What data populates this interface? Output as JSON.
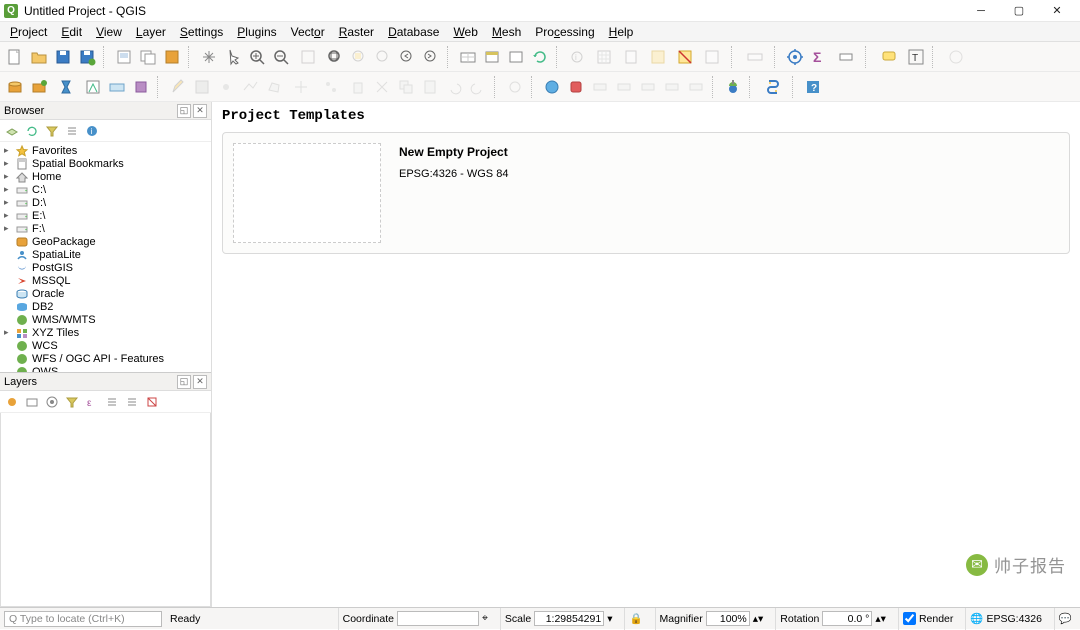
{
  "window": {
    "title": "Untitled Project - QGIS"
  },
  "menu": {
    "project": "Project",
    "edit": "Edit",
    "view": "View",
    "layer": "Layer",
    "settings": "Settings",
    "plugins": "Plugins",
    "vector": "Vector",
    "raster": "Raster",
    "database": "Database",
    "web": "Web",
    "mesh": "Mesh",
    "processing": "Processing",
    "help": "Help"
  },
  "browser": {
    "title": "Browser",
    "items": [
      {
        "label": "Favorites",
        "icon": "star",
        "expand": true
      },
      {
        "label": "Spatial Bookmarks",
        "icon": "bookmark",
        "expand": true
      },
      {
        "label": "Home",
        "icon": "home",
        "expand": true
      },
      {
        "label": "C:\\",
        "icon": "drive",
        "expand": true
      },
      {
        "label": "D:\\",
        "icon": "drive",
        "expand": true
      },
      {
        "label": "E:\\",
        "icon": "drive",
        "expand": true
      },
      {
        "label": "F:\\",
        "icon": "drive",
        "expand": true
      },
      {
        "label": "GeoPackage",
        "icon": "geopackage",
        "expand": false
      },
      {
        "label": "SpatiaLite",
        "icon": "spatialite",
        "expand": false
      },
      {
        "label": "PostGIS",
        "icon": "postgis",
        "expand": false
      },
      {
        "label": "MSSQL",
        "icon": "mssql",
        "expand": false
      },
      {
        "label": "Oracle",
        "icon": "oracle",
        "expand": false
      },
      {
        "label": "DB2",
        "icon": "db2",
        "expand": false
      },
      {
        "label": "WMS/WMTS",
        "icon": "wms",
        "expand": false
      },
      {
        "label": "XYZ Tiles",
        "icon": "xyz",
        "expand": true
      },
      {
        "label": "WCS",
        "icon": "wcs",
        "expand": false
      },
      {
        "label": "WFS / OGC API - Features",
        "icon": "wfs",
        "expand": false
      },
      {
        "label": "OWS",
        "icon": "ows",
        "expand": false
      }
    ]
  },
  "layers": {
    "title": "Layers"
  },
  "content": {
    "heading": "Project Templates",
    "template": {
      "title": "New Empty Project",
      "subtitle": "EPSG:4326 - WGS 84"
    }
  },
  "status": {
    "locate_placeholder": "Q Type to locate (Ctrl+K)",
    "ready": "Ready",
    "coord_label": "Coordinate",
    "coord_value": "",
    "scale_label": "Scale",
    "scale_value": "1:29854291",
    "mag_label": "Magnifier",
    "mag_value": "100%",
    "rot_label": "Rotation",
    "rot_value": "0.0 °",
    "render": "Render",
    "epsg": "EPSG:4326"
  },
  "watermark": "帅子报告"
}
